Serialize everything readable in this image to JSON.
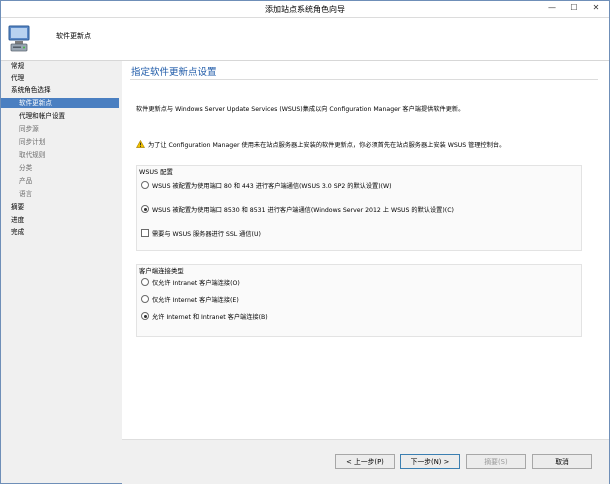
{
  "window": {
    "title": "添加站点系统角色向导",
    "controls": {
      "minimize": "—",
      "maximize": "☐",
      "close": "✕"
    }
  },
  "header": {
    "page_label": "软件更新点"
  },
  "nav": {
    "items": [
      {
        "label": "常规",
        "level": 0,
        "state": "normal"
      },
      {
        "label": "代理",
        "level": 0,
        "state": "normal"
      },
      {
        "label": "系统角色选择",
        "level": 0,
        "state": "normal"
      },
      {
        "label": "软件更新点",
        "level": 1,
        "state": "selected"
      },
      {
        "label": "代理和帐户设置",
        "level": 1,
        "state": "normal"
      },
      {
        "label": "同步源",
        "level": 1,
        "state": "dim"
      },
      {
        "label": "同步计划",
        "level": 1,
        "state": "dim"
      },
      {
        "label": "取代规则",
        "level": 1,
        "state": "dim"
      },
      {
        "label": "分类",
        "level": 1,
        "state": "dim"
      },
      {
        "label": "产品",
        "level": 1,
        "state": "dim"
      },
      {
        "label": "语言",
        "level": 1,
        "state": "dim"
      },
      {
        "label": "摘要",
        "level": 0,
        "state": "normal"
      },
      {
        "label": "进度",
        "level": 0,
        "state": "normal"
      },
      {
        "label": "完成",
        "level": 0,
        "state": "normal"
      }
    ]
  },
  "main": {
    "title": "指定软件更新点设置",
    "intro": "软件更新点与 Windows Server Update Services (WSUS)集成以向 Configuration Manager 客户端提供软件更新。",
    "warning": "为了让 Configuration Manager 使用未在站点服务器上安装的软件更新点，你必须首先在站点服务器上安装 WSUS 管理控制台。",
    "wsus_group": {
      "label": "WSUS 配置",
      "options": [
        {
          "label": "WSUS 被配置为使用端口 80 和 443 进行客户端通信(WSUS 3.0 SP2 的默认设置)(W)",
          "selected": false
        },
        {
          "label": "WSUS 被配置为使用端口 8530 和 8531 进行客户端通信(Windows Server 2012 上 WSUS 的默认设置)(C)",
          "selected": true
        }
      ],
      "ssl_checkbox": {
        "label": "需要与 WSUS 服务器进行 SSL 通信(U)",
        "checked": false
      }
    },
    "client_group": {
      "label": "客户端连接类型",
      "options": [
        {
          "label": "仅允许 Intranet 客户端连接(O)",
          "selected": false
        },
        {
          "label": "仅允许 Internet 客户端连接(E)",
          "selected": false
        },
        {
          "label": "允许 Internet 和 Intranet 客户端连接(B)",
          "selected": true
        }
      ]
    }
  },
  "footer": {
    "prev": "< 上一步(P)",
    "next": "下一步(N) >",
    "summary": "摘要(S)",
    "cancel": "取消"
  }
}
